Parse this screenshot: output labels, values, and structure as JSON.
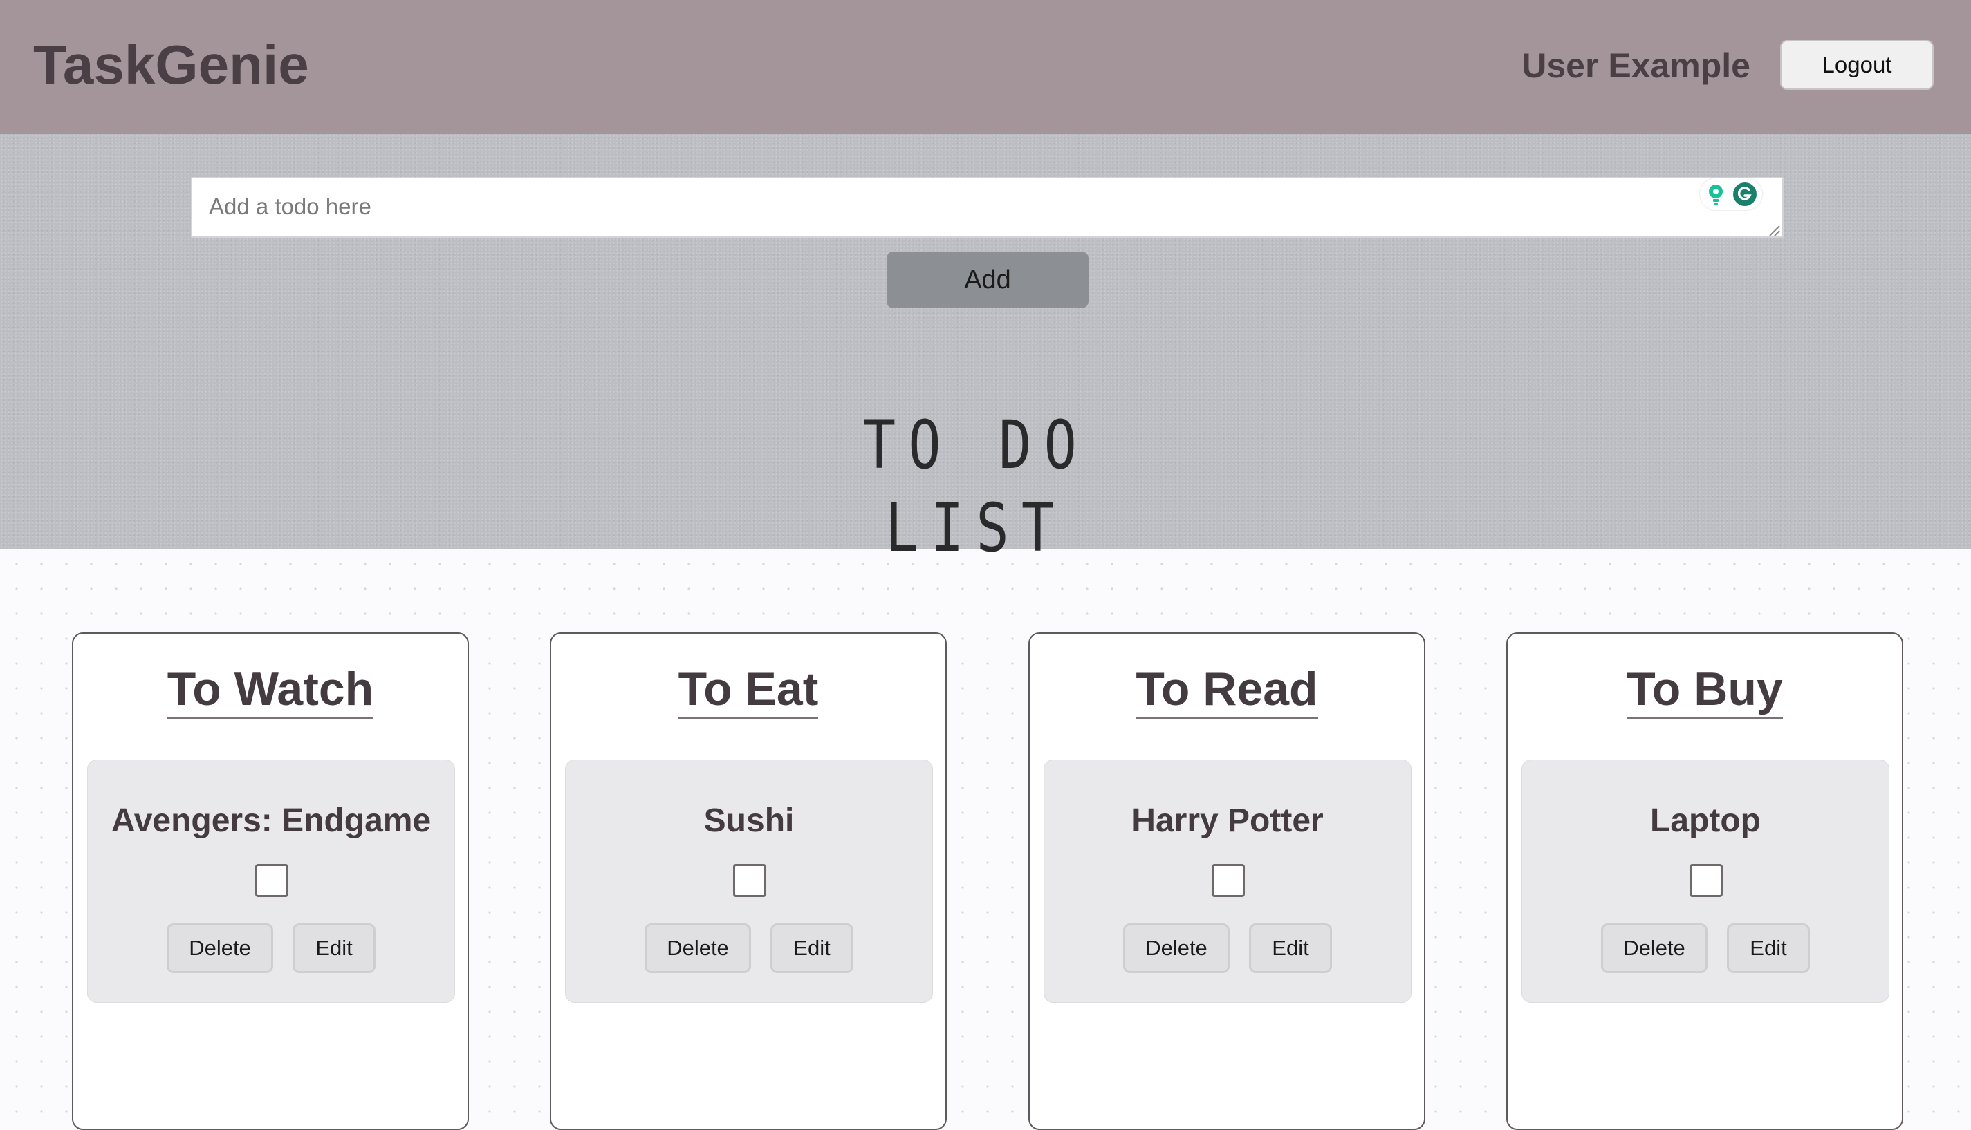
{
  "app": {
    "title": "TaskGenie"
  },
  "header": {
    "user_name": "User Example",
    "logout_label": "Logout"
  },
  "composer": {
    "placeholder": "Add a todo here",
    "value": "",
    "add_label": "Add"
  },
  "hero": {
    "title": "TO DO LIST"
  },
  "columns": [
    {
      "title": "To Watch",
      "items": [
        {
          "title": "Avengers: Endgame",
          "checked": false,
          "delete_label": "Delete",
          "edit_label": "Edit"
        }
      ]
    },
    {
      "title": "To Eat",
      "items": [
        {
          "title": "Sushi",
          "checked": false,
          "delete_label": "Delete",
          "edit_label": "Edit"
        }
      ]
    },
    {
      "title": "To Read",
      "items": [
        {
          "title": "Harry Potter",
          "checked": false,
          "delete_label": "Delete",
          "edit_label": "Edit"
        }
      ]
    },
    {
      "title": "To Buy",
      "items": [
        {
          "title": "Laptop",
          "checked": false,
          "delete_label": "Delete",
          "edit_label": "Edit"
        }
      ]
    }
  ],
  "icons": {
    "extension_a": "lightbulb-icon",
    "extension_b": "grammarly-icon",
    "extension_colors": [
      "#15c39a",
      "#1a7f6b"
    ]
  },
  "colors": {
    "header_bg": "#a39599",
    "brand_text": "#4a3f44",
    "add_button": "#8c9095",
    "card_bg": "#e9e8eb"
  }
}
